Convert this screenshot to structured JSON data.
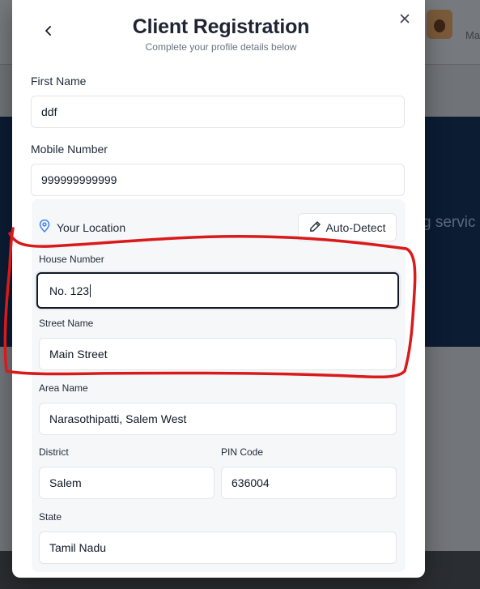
{
  "background": {
    "hero_text": "g servic",
    "user_text": "Ma"
  },
  "modal": {
    "title": "Client Registration",
    "subtitle": "Complete your profile details below",
    "first_name": {
      "label": "First Name",
      "value": "ddf"
    },
    "mobile": {
      "label": "Mobile Number",
      "value": "999999999999"
    },
    "location": {
      "title": "Your Location",
      "auto_detect_label": "Auto-Detect",
      "house_number": {
        "label": "House Number",
        "value": "No. 123"
      },
      "street_name": {
        "label": "Street Name",
        "value": "Main Street"
      },
      "area_name": {
        "label": "Area Name",
        "value": "Narasothipatti, Salem West"
      },
      "district": {
        "label": "District",
        "value": "Salem"
      },
      "pin_code": {
        "label": "PIN Code",
        "value": "636004"
      },
      "state": {
        "label": "State",
        "value": "Tamil Nadu"
      }
    }
  },
  "icons": {
    "back": "chevron-left-icon",
    "close": "close-icon",
    "location": "map-pin-icon",
    "edit": "pencil-icon"
  },
  "colors": {
    "accent_pin": "#3b82f6",
    "annotation": "#d91a1a",
    "hero_background": "#0b1c33"
  }
}
